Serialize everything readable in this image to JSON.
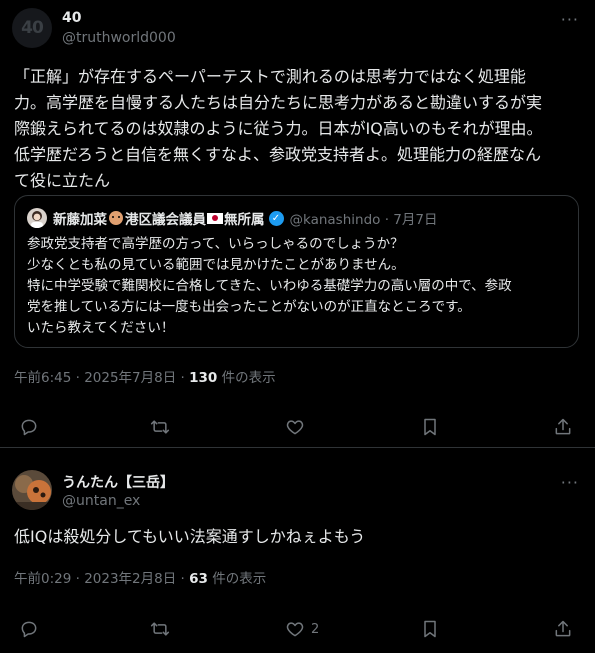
{
  "post1": {
    "avatar_text": "40",
    "name": "40",
    "handle": "@truthworld000",
    "more": "···",
    "text_lines": [
      "「正解」が存在するペーパーテストで測れるのは思考力ではなく処理能",
      "力。高学歴を自慢する人たちは自分たちに思考力があると勘違いするが実",
      "際鍛えられてるのは奴隷のように従う力。日本がIQ高いのもそれが理由。",
      "低学歴だろうと自信を無くすなよ、参政党支持者よ。処理能力の経歴なん",
      "て役に立たん"
    ],
    "quote": {
      "name_part1": "新藤加菜",
      "name_part2": "港区議会議員",
      "name_part3": "無所属",
      "handle_date": "@kanashindo · 7月7日",
      "lines": [
        "参政党支持者で高学歴の方って、いらっしゃるのでしょうか？",
        "少なくとも私の見ている範囲では見かけたことがありません。",
        "特に中学受験で難関校に合格してきた、いわゆる基礎学力の高い層の中で、参政",
        "党を推している方には一度も出会ったことがないのが正直なところです。",
        "いたら教えてください！"
      ]
    },
    "meta_prefix": "午前6:45 · 2025年7月8日 · ",
    "views": "130",
    "views_suffix": " 件の表示"
  },
  "post2": {
    "name": "うんたん【三岳】",
    "handle": "@untan_ex",
    "text": "低IQは殺処分してもいい法案通すしかねぇよもう",
    "meta_prefix": "午前0:29 · 2023年2月8日 · ",
    "views": "63",
    "views_suffix": " 件の表示",
    "like_count": "2"
  },
  "icons": [
    "reply-icon",
    "repost-icon",
    "like-icon",
    "bookmark-icon",
    "share-icon"
  ],
  "colors": {
    "background": "#000000",
    "text": "#e7e9ea",
    "muted": "#71767b",
    "border": "#2f3336",
    "verified": "#1d9bf0"
  }
}
